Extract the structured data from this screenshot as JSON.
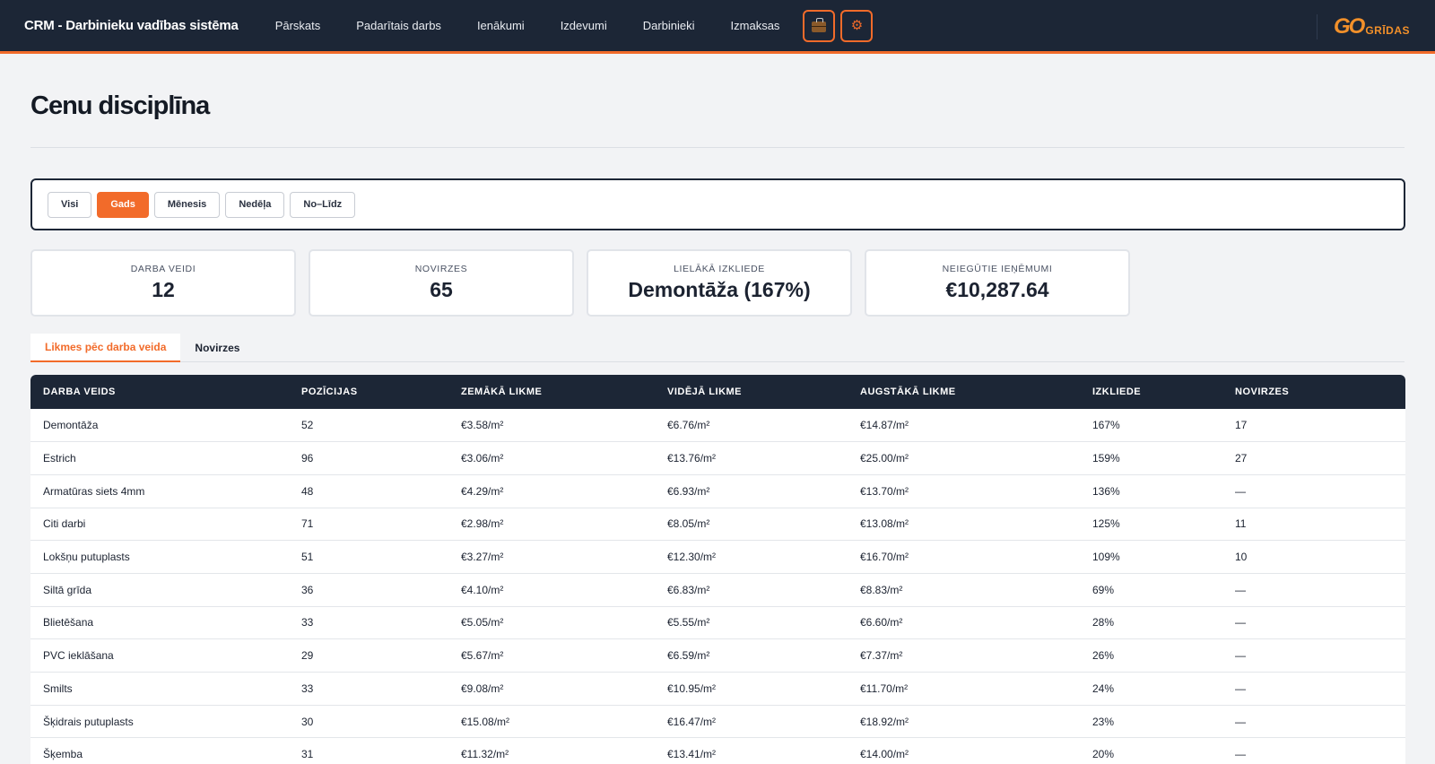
{
  "header": {
    "brand": "CRM - Darbinieku vadības sistēma",
    "nav": [
      "Pārskats",
      "Padarītais darbs",
      "Ienākumi",
      "Izdevumi",
      "Darbinieki",
      "Izmaksas"
    ],
    "icons": [
      "briefcase-icon",
      "gear-icon"
    ],
    "logo": {
      "mark": "GO",
      "text": "GRĪDAS"
    },
    "accent": "#f26b2a",
    "bg": "#1c2636"
  },
  "page": {
    "title": "Cenu disciplīna"
  },
  "filters": {
    "options": [
      "Visi",
      "Gads",
      "Mēnesis",
      "Nedēļa",
      "No–Līdz"
    ],
    "active": "Gads"
  },
  "stats": [
    {
      "label": "DARBA VEIDI",
      "value": "12"
    },
    {
      "label": "NOVIRZES",
      "value": "65"
    },
    {
      "label": "LIELĀKĀ IZKLIEDE",
      "value": "Demontāža (167%)"
    },
    {
      "label": "NEIEGŪTIE IEŅĒMUMI",
      "value": "€10,287.64"
    }
  ],
  "tabs": [
    "Likmes pēc darba veida",
    "Novirzes"
  ],
  "table": {
    "columns": [
      "DARBA VEIDS",
      "POZĪCIJAS",
      "ZEMĀKĀ LIKME",
      "VIDĒJĀ LIKME",
      "AUGSTĀKĀ LIKME",
      "IZKLIEDE",
      "NOVIRZES"
    ],
    "rows": [
      [
        "Demontāža",
        "52",
        "€3.58/m²",
        "€6.76/m²",
        "€14.87/m²",
        "167%",
        "17"
      ],
      [
        "Estrich",
        "96",
        "€3.06/m²",
        "€13.76/m²",
        "€25.00/m²",
        "159%",
        "27"
      ],
      [
        "Armatūras siets 4mm",
        "48",
        "€4.29/m²",
        "€6.93/m²",
        "€13.70/m²",
        "136%",
        "—"
      ],
      [
        "Citi darbi",
        "71",
        "€2.98/m²",
        "€8.05/m²",
        "€13.08/m²",
        "125%",
        "11"
      ],
      [
        "Lokšņu putuplasts",
        "51",
        "€3.27/m²",
        "€12.30/m²",
        "€16.70/m²",
        "109%",
        "10"
      ],
      [
        "Siltā grīda",
        "36",
        "€4.10/m²",
        "€6.83/m²",
        "€8.83/m²",
        "69%",
        "—"
      ],
      [
        "Blietēšana",
        "33",
        "€5.05/m²",
        "€5.55/m²",
        "€6.60/m²",
        "28%",
        "—"
      ],
      [
        "PVC ieklāšana",
        "29",
        "€5.67/m²",
        "€6.59/m²",
        "€7.37/m²",
        "26%",
        "—"
      ],
      [
        "Smilts",
        "33",
        "€9.08/m²",
        "€10.95/m²",
        "€11.70/m²",
        "24%",
        "—"
      ],
      [
        "Šķidrais putuplasts",
        "30",
        "€15.08/m²",
        "€16.47/m²",
        "€18.92/m²",
        "23%",
        "—"
      ],
      [
        "Šķemba",
        "31",
        "€11.32/m²",
        "€13.41/m²",
        "€14.00/m²",
        "20%",
        "—"
      ]
    ]
  }
}
